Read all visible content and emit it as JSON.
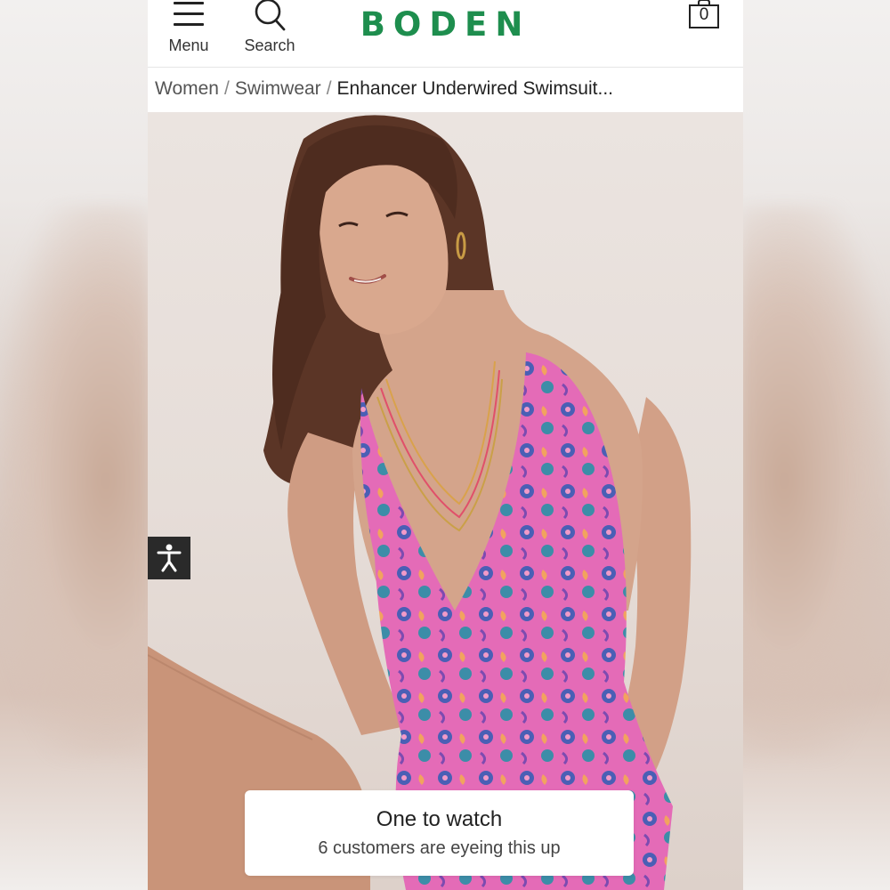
{
  "header": {
    "menu_label": "Menu",
    "search_label": "Search",
    "brand": "BODEN",
    "bag_count": "0"
  },
  "breadcrumb": {
    "items": [
      "Women",
      "Swimwear"
    ],
    "current": "Enhancer Underwired Swimsuit..."
  },
  "toast": {
    "title": "One to watch",
    "subtitle": "6 customers are eyeing this up"
  },
  "colors": {
    "brand": "#1e8e4e",
    "swimsuit": "#e46bb7"
  }
}
